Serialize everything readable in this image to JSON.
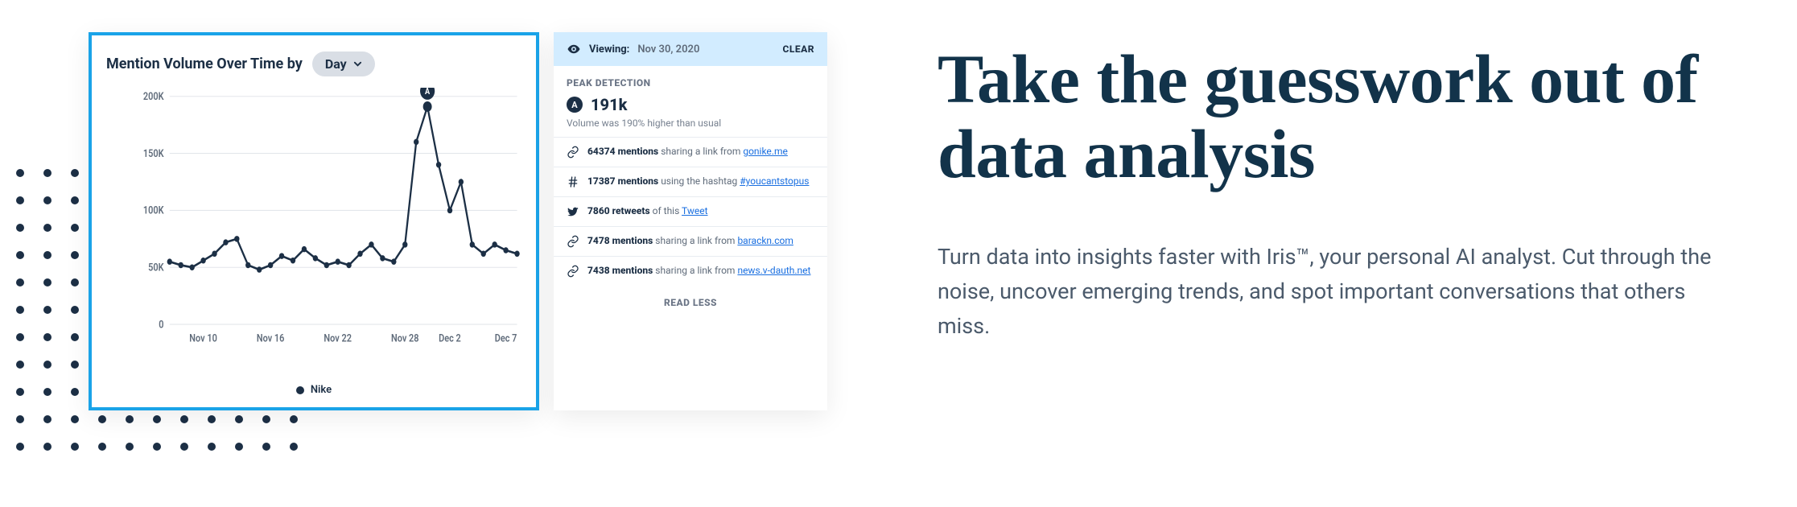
{
  "chart": {
    "title_prefix": "Mention Volume Over Time by",
    "granularity_label": "Day",
    "legend_series": "Nike"
  },
  "chart_data": {
    "type": "line",
    "title": "Mention Volume Over Time by Day",
    "xlabel": "",
    "ylabel": "",
    "ylim": [
      0,
      200000
    ],
    "yticks": [
      0,
      50000,
      100000,
      150000,
      200000
    ],
    "ytick_labels": [
      "0",
      "50K",
      "100K",
      "150K",
      "200K"
    ],
    "categories": [
      "Nov 7",
      "Nov 8",
      "Nov 9",
      "Nov 10",
      "Nov 11",
      "Nov 12",
      "Nov 13",
      "Nov 14",
      "Nov 15",
      "Nov 16",
      "Nov 17",
      "Nov 18",
      "Nov 19",
      "Nov 20",
      "Nov 21",
      "Nov 22",
      "Nov 23",
      "Nov 24",
      "Nov 25",
      "Nov 26",
      "Nov 27",
      "Nov 28",
      "Nov 29",
      "Nov 30",
      "Dec 1",
      "Dec 2",
      "Dec 3",
      "Dec 4",
      "Dec 5",
      "Dec 6",
      "Dec 7",
      "Dec 8"
    ],
    "xtick_labels": [
      "Nov 10",
      "Nov 16",
      "Nov 22",
      "Nov 28",
      "Dec 2",
      "Dec 7"
    ],
    "xtick_indices": [
      3,
      9,
      15,
      21,
      25,
      30
    ],
    "series": [
      {
        "name": "Nike",
        "values": [
          55000,
          52000,
          50000,
          56000,
          62000,
          72000,
          75000,
          52000,
          48000,
          52000,
          60000,
          56000,
          66000,
          58000,
          52000,
          55000,
          52000,
          62000,
          70000,
          58000,
          55000,
          70000,
          160000,
          191000,
          140000,
          100000,
          125000,
          70000,
          62000,
          70000,
          65000,
          62000
        ]
      }
    ],
    "annotations": [
      {
        "index": 23,
        "label": "A",
        "value": 191000
      }
    ]
  },
  "side": {
    "viewing_label": "Viewing:",
    "viewing_date": "Nov 30, 2020",
    "clear": "CLEAR",
    "section_title": "PEAK DETECTION",
    "peak_marker": "A",
    "peak_value": "191k",
    "peak_subtext": "Volume was 190% higher than usual",
    "rows": [
      {
        "icon": "link-icon",
        "strong": "64374 mentions",
        "text": " sharing a link from ",
        "link": "gonike.me"
      },
      {
        "icon": "hashtag-icon",
        "strong": "17387 mentions",
        "text": " using the hashtag ",
        "link": "#youcantstopus"
      },
      {
        "icon": "twitter-icon",
        "strong": "7860 retweets",
        "text": " of this ",
        "link": "Tweet"
      },
      {
        "icon": "link-icon",
        "strong": "7478 mentions",
        "text": " sharing a link from ",
        "link": "barackn.com"
      },
      {
        "icon": "link-icon",
        "strong": "7438 mentions",
        "text": " sharing a link from ",
        "link": "news.v-dauth.net"
      }
    ],
    "read_less": "READ LESS"
  },
  "copy": {
    "headline": "Take the guesswork out of data analysis",
    "subcopy": "Turn data into insights faster with Iris™, your personal AI analyst. Cut through the noise, uncover emerging trends, and spot important conversations that others miss."
  }
}
